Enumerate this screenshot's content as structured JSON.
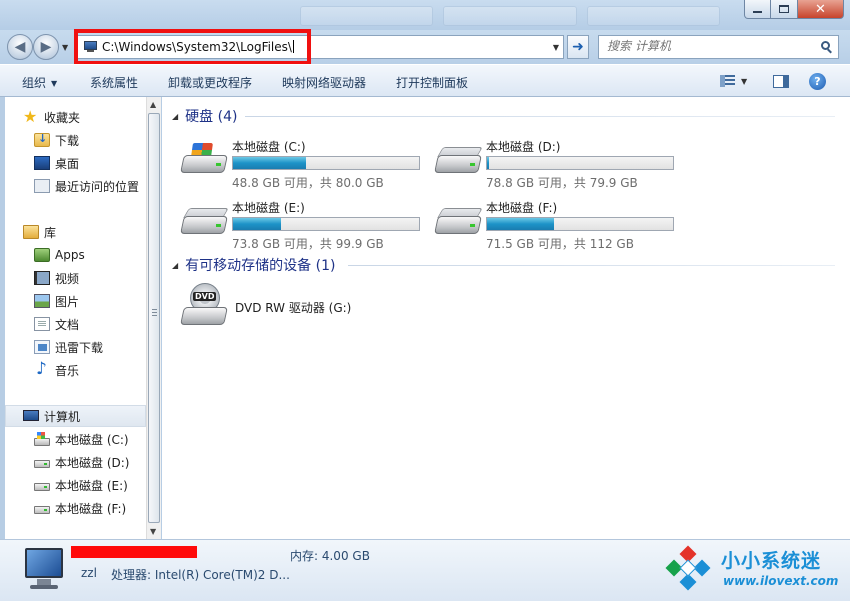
{
  "address": {
    "path": "C:\\Windows\\System32\\LogFiles\\",
    "search_placeholder": "搜索 计算机"
  },
  "toolbar": {
    "organize": "组织",
    "system_properties": "系统属性",
    "uninstall": "卸载或更改程序",
    "map_drive": "映射网络驱动器",
    "control_panel": "打开控制面板"
  },
  "nav": {
    "favorites": "收藏夹",
    "downloads": "下载",
    "desktop": "桌面",
    "recent": "最近访问的位置",
    "libraries": "库",
    "apps": "Apps",
    "videos": "视频",
    "pictures": "图片",
    "documents": "文档",
    "xunlei": "迅雷下载",
    "music": "音乐",
    "computer": "计算机",
    "drives": [
      "本地磁盘 (C:)",
      "本地磁盘 (D:)",
      "本地磁盘 (E:)",
      "本地磁盘 (F:)"
    ]
  },
  "content": {
    "hard_disks_header": "硬盘 (4)",
    "removable_header": "有可移动存储的设备 (1)",
    "drives": [
      {
        "name": "本地磁盘 (C:)",
        "free": "48.8 GB 可用，共 80.0 GB",
        "used_fraction": 0.39
      },
      {
        "name": "本地磁盘 (D:)",
        "free": "78.8 GB 可用，共 79.9 GB",
        "used_fraction": 0.01
      },
      {
        "name": "本地磁盘 (E:)",
        "free": "73.8 GB 可用，共 99.9 GB",
        "used_fraction": 0.26
      },
      {
        "name": "本地磁盘 (F:)",
        "free": "71.5 GB 可用，共 112 GB",
        "used_fraction": 0.36
      }
    ],
    "dvd": {
      "name": "DVD RW 驱动器 (G:)",
      "icon_label": "DVD"
    }
  },
  "details": {
    "user": "zzl",
    "processor": "处理器: Intel(R) Core(TM)2 D...",
    "memory": "内存: 4.00 GB"
  },
  "watermark": {
    "title": "小小系统迷",
    "url": "www.ilovext.com"
  },
  "colors": {
    "highlight": "#f01010",
    "bar_fill": "#1d93c8",
    "group_title": "#1e3287"
  }
}
